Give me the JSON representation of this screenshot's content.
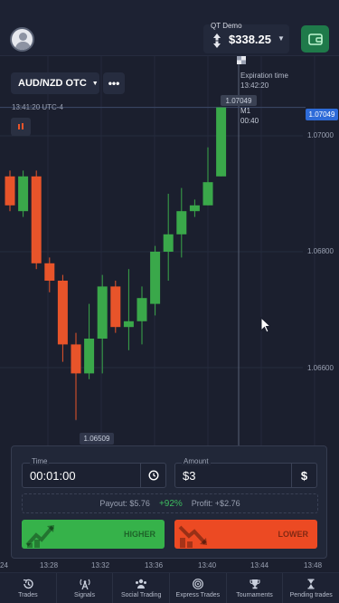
{
  "header": {
    "account_mode": "QT Demo",
    "balance": "$338.25"
  },
  "chart": {
    "pair": "AUD/NZD OTC",
    "clock": "13:41:20   UTC-4",
    "expiration_label": "Expiration time",
    "expiration_time": "13:42:20",
    "current_price": "1.07049",
    "timeframe": "M1",
    "timer": "00:40",
    "price_tag": "1.07049",
    "low_price": "1.06509",
    "y_labels": [
      "1.07000",
      "1.06800",
      "1.06600"
    ],
    "x_labels": [
      "24",
      "13:28",
      "13:32",
      "13:36",
      "13:40",
      "13:44",
      "13:48"
    ]
  },
  "chart_data": {
    "type": "candlestick",
    "y_ticks": [
      1.07,
      1.068,
      1.066
    ],
    "candles": [
      {
        "o": 1.0693,
        "c": 1.0688,
        "h": 1.0694,
        "l": 1.0687
      },
      {
        "o": 1.0687,
        "c": 1.0693,
        "h": 1.0694,
        "l": 1.0686
      },
      {
        "o": 1.0693,
        "c": 1.0678,
        "h": 1.0694,
        "l": 1.0677
      },
      {
        "o": 1.0678,
        "c": 1.0675,
        "h": 1.0679,
        "l": 1.0673
      },
      {
        "o": 1.0675,
        "c": 1.0664,
        "h": 1.0676,
        "l": 1.0661
      },
      {
        "o": 1.0664,
        "c": 1.0659,
        "h": 1.0666,
        "l": 1.0651
      },
      {
        "o": 1.0659,
        "c": 1.0665,
        "h": 1.0671,
        "l": 1.0658
      },
      {
        "o": 1.0665,
        "c": 1.0674,
        "h": 1.0676,
        "l": 1.0659
      },
      {
        "o": 1.0674,
        "c": 1.0667,
        "h": 1.0675,
        "l": 1.0666
      },
      {
        "o": 1.0667,
        "c": 1.0668,
        "h": 1.0677,
        "l": 1.0663
      },
      {
        "o": 1.0668,
        "c": 1.0672,
        "h": 1.0674,
        "l": 1.0664
      },
      {
        "o": 1.0671,
        "c": 1.068,
        "h": 1.0681,
        "l": 1.0669
      },
      {
        "o": 1.068,
        "c": 1.0683,
        "h": 1.069,
        "l": 1.0675
      },
      {
        "o": 1.0683,
        "c": 1.0687,
        "h": 1.0691,
        "l": 1.0679
      },
      {
        "o": 1.0687,
        "c": 1.0688,
        "h": 1.0689,
        "l": 1.0686
      },
      {
        "o": 1.0688,
        "c": 1.0692,
        "h": 1.0698,
        "l": 1.0688
      },
      {
        "o": 1.0693,
        "c": 1.07049,
        "h": 1.07049,
        "l": 1.0693
      }
    ],
    "x_labels": [
      "24",
      "13:28",
      "13:32",
      "13:36",
      "13:40",
      "13:44",
      "13:48"
    ],
    "current_price": 1.07049,
    "low_marker": 1.06509
  },
  "trade": {
    "time_label": "Time",
    "time_value": "00:01:00",
    "amount_label": "Amount",
    "amount_value": "$3",
    "currency_symbol": "$",
    "payout_text": "Payout: $5.76",
    "payout_pct": "+92%",
    "profit_text": "Profit: +$2.76",
    "higher_label": "HIGHER",
    "lower_label": "LOWER"
  },
  "nav": {
    "items": [
      {
        "label": "Trades",
        "icon": "history-icon"
      },
      {
        "label": "Signals",
        "icon": "antenna-icon"
      },
      {
        "label": "Social Trading",
        "icon": "people-icon"
      },
      {
        "label": "Express Trades",
        "icon": "target-icon"
      },
      {
        "label": "Tournaments",
        "icon": "trophy-icon"
      },
      {
        "label": "Pending trades",
        "icon": "hourglass-icon"
      }
    ]
  },
  "colors": {
    "bull": "#3aa84a",
    "bear": "#e8542a",
    "accent": "#2e6bd8"
  }
}
